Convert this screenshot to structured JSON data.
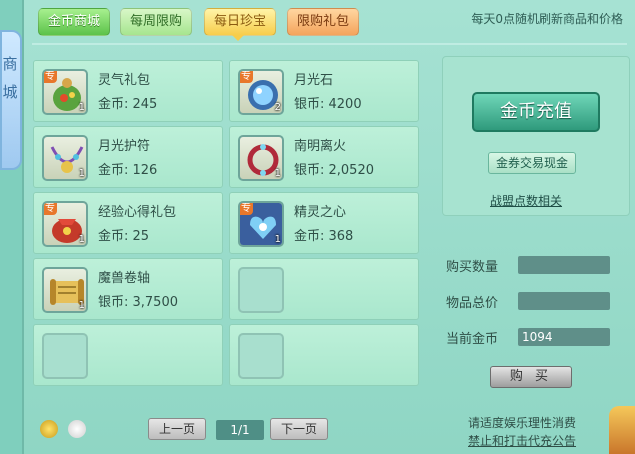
{
  "side": {
    "text": "商城"
  },
  "tabs": [
    {
      "label": "金币商城"
    },
    {
      "label": "每周限购"
    },
    {
      "label": "每日珍宝"
    },
    {
      "label": "限购礼包"
    }
  ],
  "top_tip": "每天0点随机刷新商品和价格",
  "items": [
    {
      "name": "灵气礼包",
      "price": "金币: 245",
      "qty": "1",
      "special": "专",
      "icon": "spirit-gift-icon"
    },
    {
      "name": "月光石",
      "price": "银币: 4200",
      "qty": "2",
      "special": "专",
      "icon": "moonstone-icon"
    },
    {
      "name": "月光护符",
      "price": "金币: 126",
      "qty": "1",
      "special": "",
      "icon": "moon-amulet-icon"
    },
    {
      "name": "南明离火",
      "price": "银币: 2,0520",
      "qty": "1",
      "special": "",
      "icon": "fire-bracelet-icon"
    },
    {
      "name": "经验心得礼包",
      "price": "金币: 25",
      "qty": "1",
      "special": "专",
      "icon": "exp-bag-icon"
    },
    {
      "name": "精灵之心",
      "price": "金币: 368",
      "qty": "1",
      "special": "专",
      "icon": "spirit-heart-icon"
    },
    {
      "name": "魔兽卷轴",
      "price": "银币: 3,7500",
      "qty": "1",
      "special": "",
      "icon": "scroll-icon"
    }
  ],
  "pagination": {
    "prev": "上一页",
    "page": "1/1",
    "next": "下一页"
  },
  "right": {
    "charge": "金币充值",
    "exchange": "金券交易现金",
    "alliance": "战盟点数相关",
    "buy_qty_label": "购买数量",
    "total_label": "物品总价",
    "coins_label": "当前金币",
    "buy_qty": "",
    "total": "",
    "coins": "1094",
    "buy": "购 买"
  },
  "notice": {
    "line1": "请适度娱乐理性消费",
    "line2": "禁止和打击代充公告"
  },
  "colors": {
    "accent": "#2f9a7c",
    "panel": "#a6e2d3"
  }
}
